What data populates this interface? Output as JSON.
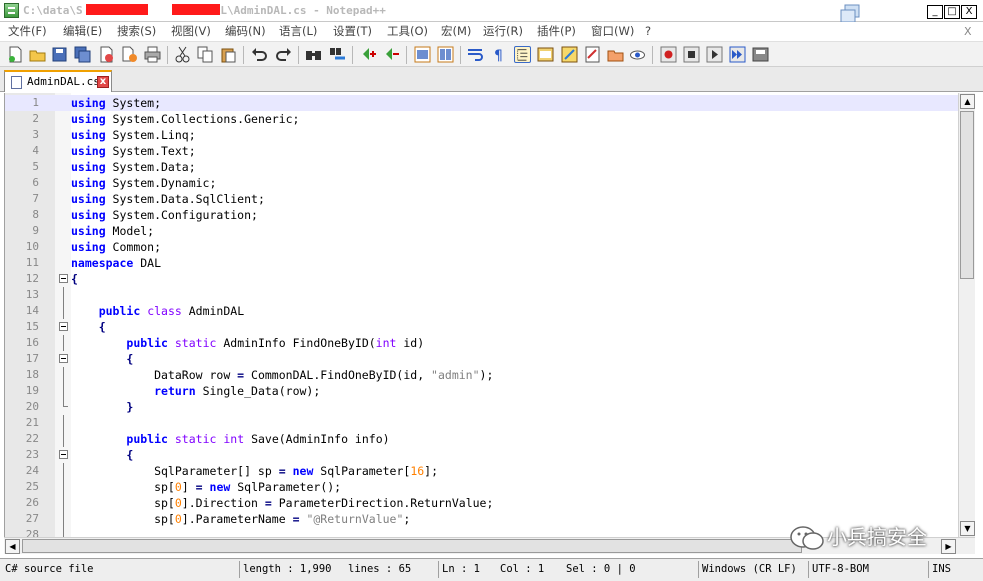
{
  "window": {
    "title_prefix": "C:\\data\\S",
    "title_mid": "S",
    "title_suffix": "mi\\DAL\\AdminDAL.cs - Notepad++",
    "minimize_label": "_",
    "maximize_label": "□",
    "close_label": "X"
  },
  "menu": {
    "items": [
      "文件(F)",
      "编辑(E)",
      "搜索(S)",
      "视图(V)",
      "编码(N)",
      "语言(L)",
      "设置(T)",
      "工具(O)",
      "宏(M)",
      "运行(R)",
      "插件(P)",
      "窗口(W)",
      "?"
    ],
    "close_label": "X"
  },
  "toolbar": {
    "icons": [
      "new-file",
      "open-file",
      "save",
      "save-all",
      "close",
      "close-all",
      "print",
      "cut",
      "copy",
      "paste",
      "undo",
      "redo",
      "find",
      "replace",
      "zoom-in",
      "zoom-out",
      "sync-vertical",
      "sync-horizontal",
      "word-wrap",
      "show-all-chars",
      "indent-guide",
      "user-lang",
      "doc-map",
      "function-list",
      "folder-workspace",
      "monitor",
      "record-macro",
      "stop-record",
      "play-macro",
      "run-macro-multiple",
      "save-macro"
    ]
  },
  "tab": {
    "label": "AdminDAL.cs",
    "close_label": "x"
  },
  "editor": {
    "lines": [
      {
        "n": "1",
        "tokens": [
          {
            "t": "using",
            "c": "kw"
          },
          {
            "t": " System;"
          }
        ]
      },
      {
        "n": "2",
        "tokens": [
          {
            "t": "using",
            "c": "kw"
          },
          {
            "t": " System.Collections.Generic;"
          }
        ]
      },
      {
        "n": "3",
        "tokens": [
          {
            "t": "using",
            "c": "kw"
          },
          {
            "t": " System.Linq;"
          }
        ]
      },
      {
        "n": "4",
        "tokens": [
          {
            "t": "using",
            "c": "kw"
          },
          {
            "t": " System.Text;"
          }
        ]
      },
      {
        "n": "5",
        "tokens": [
          {
            "t": "using",
            "c": "kw"
          },
          {
            "t": " System.Data;"
          }
        ]
      },
      {
        "n": "6",
        "tokens": [
          {
            "t": "using",
            "c": "kw"
          },
          {
            "t": " System.Dynamic;"
          }
        ]
      },
      {
        "n": "7",
        "tokens": [
          {
            "t": "using",
            "c": "kw"
          },
          {
            "t": " System.Data.SqlClient;"
          }
        ]
      },
      {
        "n": "8",
        "tokens": [
          {
            "t": "using",
            "c": "kw"
          },
          {
            "t": " System.Configuration;"
          }
        ]
      },
      {
        "n": "9",
        "tokens": [
          {
            "t": "using",
            "c": "kw"
          },
          {
            "t": " Model;"
          }
        ]
      },
      {
        "n": "10",
        "tokens": [
          {
            "t": "using",
            "c": "kw"
          },
          {
            "t": " Common;"
          }
        ]
      },
      {
        "n": "11",
        "tokens": [
          {
            "t": "namespace",
            "c": "kw"
          },
          {
            "t": " DAL"
          }
        ]
      },
      {
        "n": "12",
        "tokens": [
          {
            "t": "{",
            "c": "op"
          }
        ]
      },
      {
        "n": "13",
        "tokens": []
      },
      {
        "n": "14",
        "tokens": [
          {
            "t": "    "
          },
          {
            "t": "public",
            "c": "kw"
          },
          {
            "t": " "
          },
          {
            "t": "class",
            "c": "kw2"
          },
          {
            "t": " AdminDAL"
          }
        ]
      },
      {
        "n": "15",
        "tokens": [
          {
            "t": "    "
          },
          {
            "t": "{",
            "c": "op"
          }
        ]
      },
      {
        "n": "16",
        "tokens": [
          {
            "t": "        "
          },
          {
            "t": "public",
            "c": "kw"
          },
          {
            "t": " "
          },
          {
            "t": "static",
            "c": "kw2"
          },
          {
            "t": " AdminInfo FindOneByID("
          },
          {
            "t": "int",
            "c": "kw2"
          },
          {
            "t": " id)"
          }
        ]
      },
      {
        "n": "17",
        "tokens": [
          {
            "t": "        "
          },
          {
            "t": "{",
            "c": "op"
          }
        ]
      },
      {
        "n": "18",
        "tokens": [
          {
            "t": "            DataRow row "
          },
          {
            "t": "=",
            "c": "op"
          },
          {
            "t": " CommonDAL.FindOneByID(id, "
          },
          {
            "t": "\"admin\"",
            "c": "str"
          },
          {
            "t": ");"
          }
        ]
      },
      {
        "n": "19",
        "tokens": [
          {
            "t": "            "
          },
          {
            "t": "return",
            "c": "kw"
          },
          {
            "t": " Single_Data(row);"
          }
        ]
      },
      {
        "n": "20",
        "tokens": [
          {
            "t": "        "
          },
          {
            "t": "}",
            "c": "op"
          }
        ]
      },
      {
        "n": "21",
        "tokens": []
      },
      {
        "n": "22",
        "tokens": [
          {
            "t": "        "
          },
          {
            "t": "public",
            "c": "kw"
          },
          {
            "t": " "
          },
          {
            "t": "static",
            "c": "kw2"
          },
          {
            "t": " "
          },
          {
            "t": "int",
            "c": "kw2"
          },
          {
            "t": " Save(AdminInfo info)"
          }
        ]
      },
      {
        "n": "23",
        "tokens": [
          {
            "t": "        "
          },
          {
            "t": "{",
            "c": "op"
          }
        ]
      },
      {
        "n": "24",
        "tokens": [
          {
            "t": "            SqlParameter[] sp "
          },
          {
            "t": "=",
            "c": "op"
          },
          {
            "t": " "
          },
          {
            "t": "new",
            "c": "kw"
          },
          {
            "t": " SqlParameter["
          },
          {
            "t": "16",
            "c": "num"
          },
          {
            "t": "];"
          }
        ]
      },
      {
        "n": "25",
        "tokens": [
          {
            "t": "            sp["
          },
          {
            "t": "0",
            "c": "num"
          },
          {
            "t": "] "
          },
          {
            "t": "=",
            "c": "op"
          },
          {
            "t": " "
          },
          {
            "t": "new",
            "c": "kw"
          },
          {
            "t": " SqlParameter();"
          }
        ]
      },
      {
        "n": "26",
        "tokens": [
          {
            "t": "            sp["
          },
          {
            "t": "0",
            "c": "num"
          },
          {
            "t": "].Direction "
          },
          {
            "t": "=",
            "c": "op"
          },
          {
            "t": " ParameterDirection.ReturnValue;"
          }
        ]
      },
      {
        "n": "27",
        "tokens": [
          {
            "t": "            sp["
          },
          {
            "t": "0",
            "c": "num"
          },
          {
            "t": "].ParameterName "
          },
          {
            "t": "=",
            "c": "op"
          },
          {
            "t": " "
          },
          {
            "t": "\"@ReturnValue\"",
            "c": "str"
          },
          {
            "t": ";"
          }
        ]
      },
      {
        "n": "28",
        "tokens": []
      }
    ]
  },
  "watermark": {
    "text": "小兵搞安全"
  },
  "status": {
    "file_type": "C# source file",
    "length": "length : 1,990",
    "lines": "lines : 65",
    "ln": "Ln : 1",
    "col": "Col : 1",
    "sel": "Sel : 0 | 0",
    "eol": "Windows (CR LF)",
    "encoding": "UTF-8-BOM",
    "mode": "INS"
  },
  "colors": {
    "keyword": "#0000ff",
    "keyword2": "#8000ff",
    "string": "#808080",
    "number": "#ff8000",
    "redaction": "#ff1a1a",
    "tab_accent": "#f0a000"
  }
}
